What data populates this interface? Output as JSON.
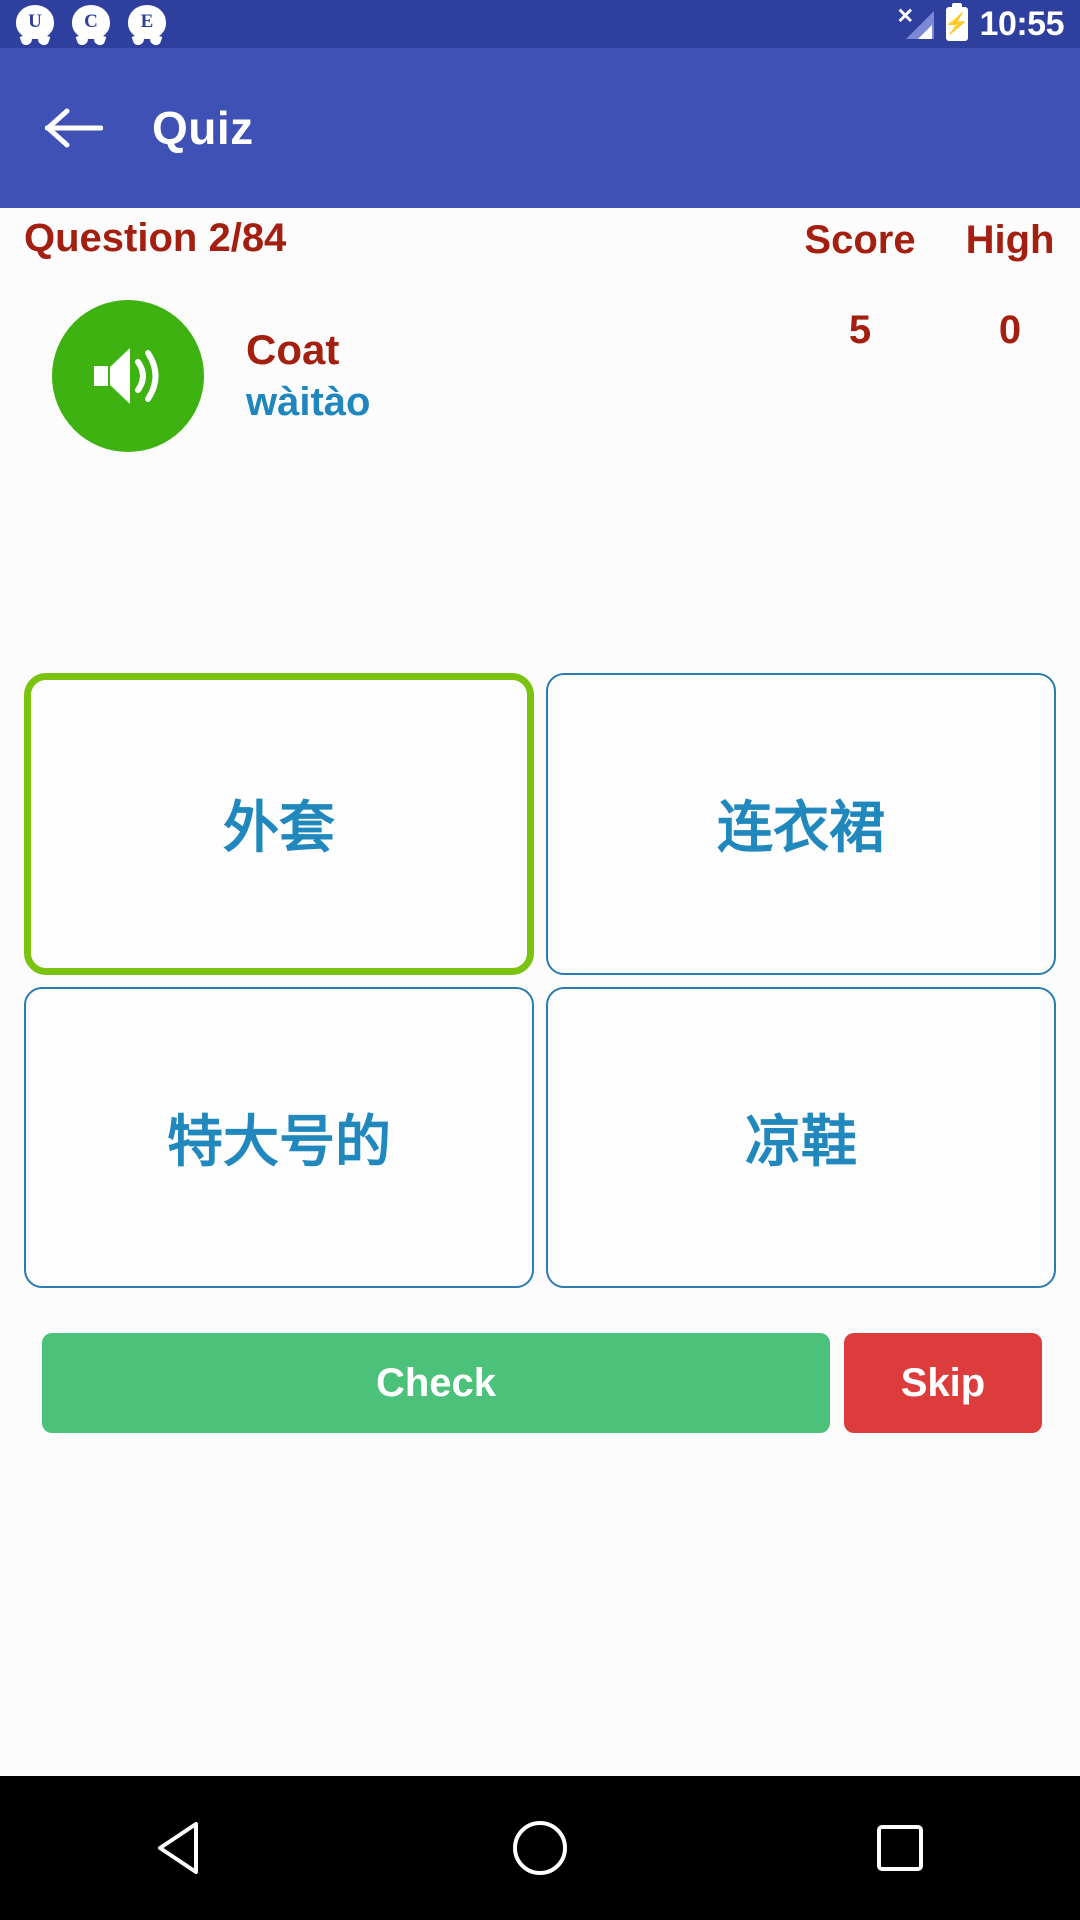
{
  "status_bar": {
    "notifications": [
      {
        "icon": "notification-bubble-icon",
        "letter": "U"
      },
      {
        "icon": "notification-bubble-icon",
        "letter": "C"
      },
      {
        "icon": "notification-bubble-icon",
        "letter": "E"
      }
    ],
    "signal_icon": "signal-no-service-icon",
    "battery_icon": "battery-charging-icon",
    "time": "10:55"
  },
  "app_bar": {
    "back_icon": "back-arrow-icon",
    "title": "Quiz",
    "background_color": "#3f51b5"
  },
  "quiz": {
    "question_label": "Question 2/84",
    "current_question": 2,
    "total_questions": 84,
    "score_label": "Score",
    "high_label": "High",
    "score_value": "5",
    "high_value": "0",
    "score_color": "#a31f10",
    "speaker_icon": "speaker-volume-icon",
    "speaker_color": "#3eb211",
    "prompt_word": "Coat",
    "prompt_pinyin": "wàitào",
    "pinyin_color": "#1f87bd",
    "options": [
      {
        "text": "外套",
        "selected": true
      },
      {
        "text": "连衣裙",
        "selected": false
      },
      {
        "text": "特大号的",
        "selected": false
      },
      {
        "text": "凉鞋",
        "selected": false
      }
    ],
    "selected_border_color": "#7ac410",
    "option_border_color": "#2b7cb0",
    "option_text_color": "#2088bd"
  },
  "actions": {
    "check_label": "Check",
    "check_color": "#4cc179",
    "skip_label": "Skip",
    "skip_color": "#dc3c3c"
  },
  "nav_bar": {
    "back_icon": "nav-back-triangle-icon",
    "home_icon": "nav-home-circle-icon",
    "recents_icon": "nav-recents-square-icon"
  }
}
